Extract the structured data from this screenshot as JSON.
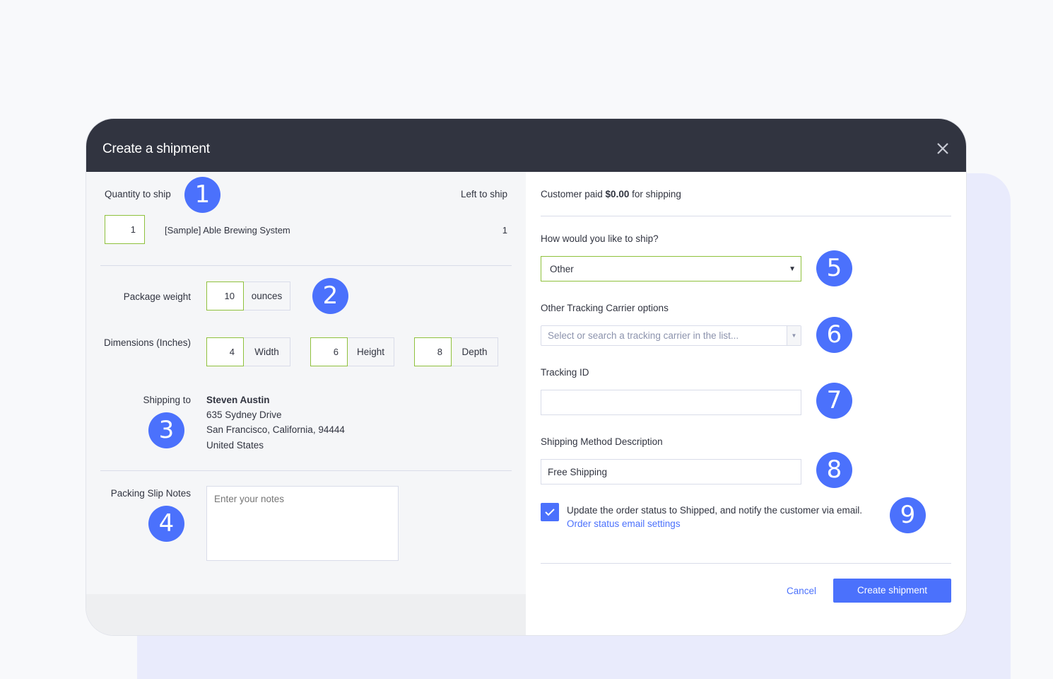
{
  "modal": {
    "title": "Create a shipment",
    "close_label": "×"
  },
  "quantity": {
    "label": "Quantity to ship",
    "left_label": "Left to ship",
    "value": "1",
    "product_name": "[Sample] Able Brewing System",
    "left_value": "1"
  },
  "package": {
    "weight_label": "Package weight",
    "weight_value": "10",
    "weight_unit": "ounces",
    "dimensions_label": "Dimensions (Inches)",
    "width_value": "4",
    "width_label": "Width",
    "height_value": "6",
    "height_label": "Height",
    "depth_value": "8",
    "depth_label": "Depth"
  },
  "shipping_to": {
    "label": "Shipping to",
    "name": "Steven Austin",
    "street": "635 Sydney Drive",
    "city_line": "San Francisco, California, 94444",
    "country": "United States"
  },
  "notes": {
    "label": "Packing Slip Notes",
    "placeholder": "Enter your notes"
  },
  "right": {
    "customer_paid_prefix": "Customer paid ",
    "customer_paid_amount": "$0.00",
    "customer_paid_suffix": " for shipping",
    "ship_method_label": "How would you like to ship?",
    "ship_method_value": "Other",
    "carrier_label": "Other Tracking Carrier options",
    "carrier_placeholder": "Select or search a tracking carrier in the list...",
    "tracking_label": "Tracking ID",
    "tracking_value": "",
    "description_label": "Shipping Method Description",
    "description_value": "Free Shipping",
    "notify_text": "Update the order status to Shipped, and notify the customer via email.",
    "notify_link": "Order status email settings",
    "notify_checked": true,
    "cancel_label": "Cancel",
    "create_label": "Create shipment"
  },
  "badges": [
    "1",
    "2",
    "3",
    "4",
    "5",
    "6",
    "7",
    "8",
    "9"
  ],
  "colors": {
    "header_bg": "#313440",
    "accent": "#4b71fc",
    "valid_border": "#8fc13d",
    "backdrop_panel": "#e9ebfc"
  }
}
